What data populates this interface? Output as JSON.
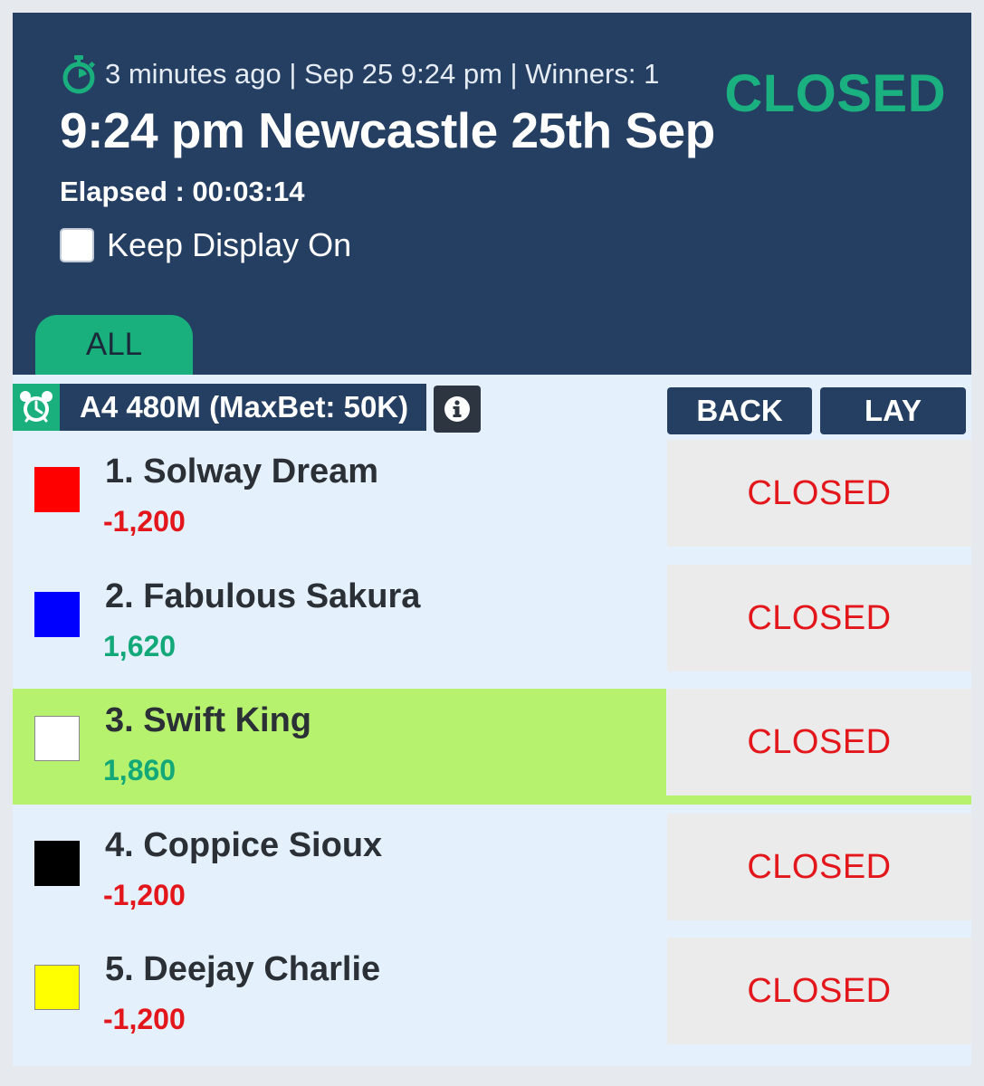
{
  "header": {
    "meta_text": "3 minutes ago | Sep 25 9:24 pm | Winners: 1",
    "race_title": "9:24 pm Newcastle 25th Sep",
    "status": "CLOSED",
    "elapsed": "Elapsed : 00:03:14",
    "keep_display_label": "Keep Display On",
    "keep_display_checked": false
  },
  "tabs": [
    {
      "label": "ALL",
      "active": true
    }
  ],
  "market": {
    "name": "A4 480M (MaxBet: 50K)",
    "back_label": "BACK",
    "lay_label": "LAY"
  },
  "runners": [
    {
      "name": "1. Solway Dream",
      "pl": "-1,200",
      "pl_sign": "neg",
      "silk_color": "#ff0000",
      "status": "CLOSED",
      "highlight": false
    },
    {
      "name": "2. Fabulous Sakura",
      "pl": "1,620",
      "pl_sign": "pos",
      "silk_color": "#0000ff",
      "status": "CLOSED",
      "highlight": false
    },
    {
      "name": "3. Swift King",
      "pl": "1,860",
      "pl_sign": "pos",
      "silk_color": "#ffffff",
      "status": "CLOSED",
      "highlight": true
    },
    {
      "name": "4. Coppice Sioux",
      "pl": "-1,200",
      "pl_sign": "neg",
      "silk_color": "#000000",
      "status": "CLOSED",
      "highlight": false
    },
    {
      "name": "5. Deejay Charlie",
      "pl": "-1,200",
      "pl_sign": "neg",
      "silk_color": "#ffff00",
      "status": "CLOSED",
      "highlight": false
    }
  ],
  "colors": {
    "header_bg": "#253f63",
    "accent_green": "#1bb07f",
    "winner_highlight": "#b7f26f",
    "closed_red": "#e3161b"
  }
}
